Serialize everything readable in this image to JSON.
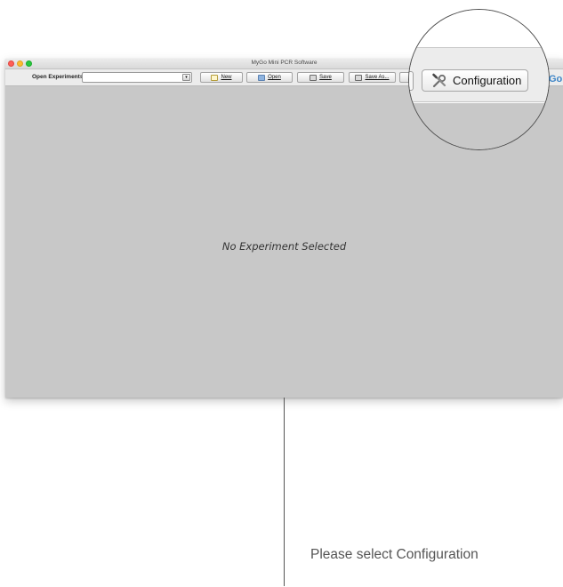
{
  "window": {
    "title": "MyGo Mini PCR Software"
  },
  "toolbar": {
    "open_experiments_label": "Open Experiments:",
    "open_experiments_value": "",
    "new_label": "New",
    "open_label": "Open",
    "save_label": "Save",
    "save_as_label": "Save As..."
  },
  "main": {
    "empty_message": "No Experiment Selected"
  },
  "magnifier": {
    "configuration_label": "Configuration"
  },
  "brand": {
    "text": "Go"
  },
  "callout": {
    "text": "Please select Configuration"
  },
  "icons": {
    "new": "new-document-icon",
    "open": "open-folder-icon",
    "save": "save-disk-icon",
    "save_as": "save-as-disk-icon",
    "configuration": "tools-icon",
    "combo": "chevron-down-icon"
  },
  "colors": {
    "window_background": "#c8c8c8",
    "toolbar_background": "#ececec",
    "brand_blue": "#3f86c7",
    "traffic_close": "#ff5f57",
    "traffic_minimize": "#febc2e",
    "traffic_zoom": "#28c840"
  }
}
